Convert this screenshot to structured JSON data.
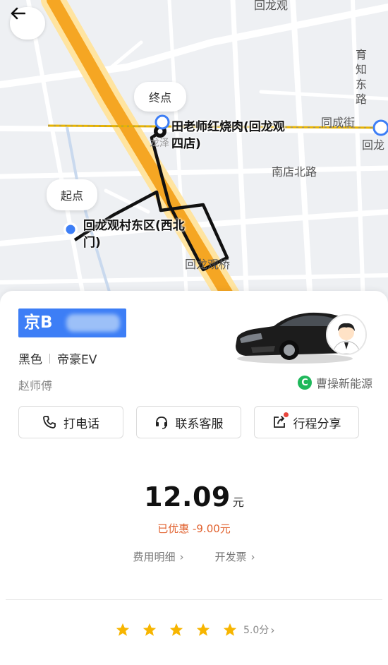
{
  "map": {
    "top_label": "回龙观",
    "east_road_vertical": "育知东路",
    "road_tongcheng": "同成街",
    "road_nandian": "南店北路",
    "bridge": "回龙观桥",
    "partial_west": "龙泽",
    "partial_east": "回龙",
    "destination_bubble": "终点",
    "destination_name": "田老师红烧肉(回龙观四店)",
    "origin_bubble": "起点",
    "origin_name": "回龙观村东区(西北门)",
    "route_color": "#222222",
    "expressway_color": "#f5a623"
  },
  "header": {
    "back_icon": "arrow-left-icon"
  },
  "vehicle": {
    "plate_prefix": "京B",
    "color": "黑色",
    "model": "帝豪EV",
    "driver": "赵师傅",
    "company": "曹操新能源",
    "company_icon_letter": "C",
    "plate_color": "#3d7ef6"
  },
  "actions": {
    "call": "打电话",
    "support": "联系客服",
    "share": "行程分享"
  },
  "fare": {
    "amount": "12.09",
    "unit": "元",
    "discount": "已优惠 -9.00元",
    "details_link": "费用明细",
    "invoice_link": "开发票",
    "accent": "#e1612e"
  },
  "rating": {
    "stars": 5,
    "score": "5.0分",
    "star_color": "#f7b500"
  }
}
